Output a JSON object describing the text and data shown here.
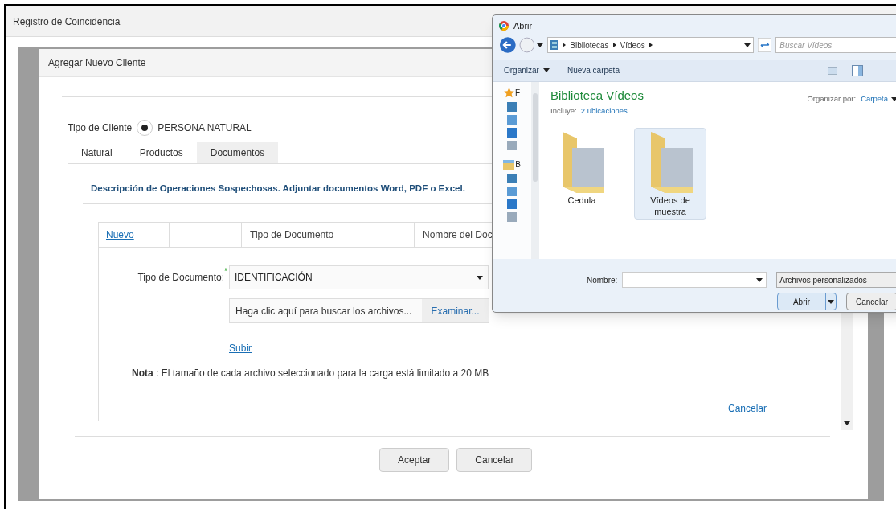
{
  "window": {
    "title": "Registro de Coincidencia"
  },
  "modal": {
    "title": "Agregar Nuevo Cliente",
    "client_type": {
      "label": "Tipo de Cliente",
      "option": "PERSONA NATURAL",
      "selected": true
    },
    "tabs": [
      {
        "label": "Natural",
        "selected": false
      },
      {
        "label": "Productos",
        "selected": false
      },
      {
        "label": "Documentos",
        "selected": true
      }
    ],
    "description": "Descripción de Operaciones Sospechosas. Adjuntar documentos Word, PDF o Excel.",
    "table": {
      "new_link": "Nuevo",
      "columns": [
        "Tipo de Documento",
        "Nombre del Doc"
      ]
    },
    "form": {
      "doc_type_label": "Tipo de Documento:",
      "required_mark": "*",
      "doc_type_value": "IDENTIFICACIÓN",
      "file_placeholder": "Haga clic aquí para buscar los archivos...",
      "browse_button": "Examinar...",
      "upload_link": "Subir",
      "note": "**Nota** : El tamaño de cada archivo seleccionado para la carga está limitado a 20 MB",
      "cancel_link": "Cancelar"
    },
    "buttons": [
      "Aceptar",
      "Cancelar"
    ]
  },
  "file_dialog": {
    "title": "Abrir",
    "breadcrumb": [
      "Bibliotecas",
      "Vídeos"
    ],
    "search_placeholder": "Buscar Vídeos",
    "toolbar": [
      {
        "label": "Organizar",
        "kind": "menu"
      },
      {
        "label": "Nueva carpeta",
        "kind": "action"
      }
    ],
    "nav_groups": [
      {
        "label": "F",
        "kind": "favorites"
      },
      {
        "label": "B",
        "kind": "libraries"
      }
    ],
    "library_title": "Biblioteca Vídeos",
    "includes_label": "Incluye:",
    "includes_link": "2 ubicaciones",
    "arrange_label": "Organizar por:",
    "arrange_value": "Carpeta",
    "folders": [
      {
        "name": "Cedula",
        "selected": false
      },
      {
        "name": "Vídeos de muestra",
        "selected": true
      }
    ],
    "filename_label": "Nombre:",
    "filetype": "Archivos personalizados",
    "open_button": "Abrir",
    "cancel_button": "Cancelar"
  }
}
